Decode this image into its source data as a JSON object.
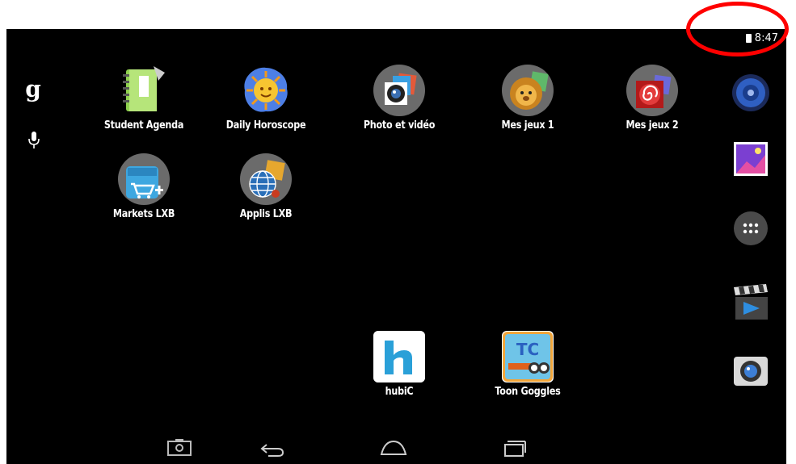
{
  "status": {
    "time": "8:47",
    "battery_icon": "battery-icon"
  },
  "annotation": {
    "color": "#ff0000",
    "shape": "ellipse"
  },
  "left_column": {
    "search_glyph": "g",
    "search_icon": "google-search-icon",
    "voice_icon": "microphone-icon"
  },
  "apps": {
    "student_agenda": {
      "label": "Student Agenda",
      "icon": "notebook-icon"
    },
    "daily_horoscope": {
      "label": "Daily Horoscope",
      "icon": "sun-icon"
    },
    "photo_video": {
      "label": "Photo et vidéo",
      "icon": "camera-folder-icon"
    },
    "mes_jeux_1": {
      "label": "Mes jeux 1",
      "icon": "lion-folder-icon"
    },
    "mes_jeux_2": {
      "label": "Mes jeux 2",
      "icon": "spiral-folder-icon"
    },
    "markets_lxb": {
      "label": "Markets LXB",
      "icon": "market-cart-icon"
    },
    "applis_lxb": {
      "label": "Applis LXB",
      "icon": "globe-folder-icon"
    },
    "hubic": {
      "label": "hubiC",
      "icon": "hubic-icon"
    },
    "toon_goggles": {
      "label": "Toon Goggles",
      "icon": "toon-goggles-icon"
    }
  },
  "dock": [
    {
      "icon": "speaker-icon"
    },
    {
      "icon": "gallery-icon"
    },
    {
      "icon": "app-drawer-icon"
    },
    {
      "icon": "movie-clapper-icon"
    },
    {
      "icon": "camera-icon"
    }
  ],
  "navbar": [
    {
      "icon": "screenshot-icon"
    },
    {
      "icon": "back-icon"
    },
    {
      "icon": "home-icon"
    },
    {
      "icon": "recent-apps-icon"
    }
  ]
}
